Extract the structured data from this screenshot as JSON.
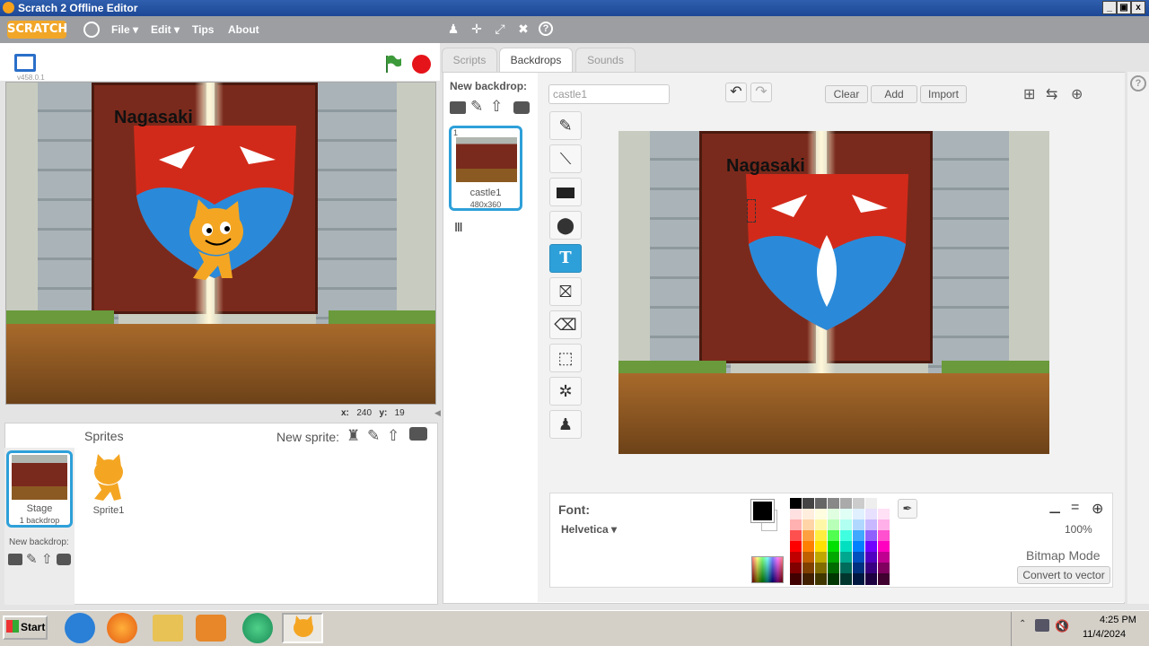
{
  "window": {
    "title": "Scratch 2 Offline Editor",
    "minimize": "_",
    "restore": "▣",
    "close": "x"
  },
  "menubar": {
    "logo": "SCRATCH",
    "items": [
      {
        "label": "File ▾"
      },
      {
        "label": "Edit ▾"
      },
      {
        "label": "Tips"
      },
      {
        "label": "About"
      }
    ],
    "tools": [
      "stamp-icon",
      "move-icon",
      "grow-icon",
      "shrink-icon",
      "help-icon"
    ]
  },
  "stage": {
    "version": "v458.0.1",
    "text_on_backdrop": "Nagasaki",
    "x_label": "x:",
    "x_value": "240",
    "y_label": "y:",
    "y_value": "19"
  },
  "sprites": {
    "title": "Sprites",
    "new_sprite_label": "New sprite:",
    "items": [
      {
        "name": "Sprite1"
      }
    ],
    "stage": {
      "label": "Stage",
      "sublabel": "1 backdrop"
    },
    "new_backdrop_label": "New backdrop:"
  },
  "tabs": [
    {
      "label": "Scripts"
    },
    {
      "label": "Backdrops"
    },
    {
      "label": "Sounds"
    }
  ],
  "backdrops": {
    "new_backdrop_label": "New backdrop:",
    "items": [
      {
        "index": "1",
        "name": "castle1",
        "size": "480x360"
      }
    ]
  },
  "paint": {
    "name_value": "castle1",
    "clear_label": "Clear",
    "add_label": "Add",
    "import_label": "Import",
    "canvas_text": "Nagasaki",
    "font_label": "Font:",
    "font_value": "Helvetica ▾",
    "zoom": "100%",
    "mode_label": "Bitmap Mode",
    "convert_label": "Convert to vector",
    "primary_color": "#000000",
    "palette": [
      [
        "#000000",
        "#444444",
        "#666666",
        "#888888",
        "#aaaaaa",
        "#cccccc",
        "#eeeeee",
        "#ffffff"
      ],
      [
        "#ffe0e0",
        "#ffeedd",
        "#fffde0",
        "#e0ffe0",
        "#e0fff5",
        "#e0f0ff",
        "#e8e0ff",
        "#ffe0f5"
      ],
      [
        "#ffb0b0",
        "#ffd5a8",
        "#fff7a8",
        "#b8ffb8",
        "#b0fff0",
        "#b0d8ff",
        "#c8b8ff",
        "#ffb0e8"
      ],
      [
        "#ff5050",
        "#ffa040",
        "#ffee40",
        "#50ff50",
        "#40ffe0",
        "#40a8ff",
        "#9060ff",
        "#ff50d0"
      ],
      [
        "#ff0000",
        "#ff8000",
        "#ffe000",
        "#00e000",
        "#00e0c0",
        "#0080ff",
        "#7000ff",
        "#ff00c0"
      ],
      [
        "#c00000",
        "#c06000",
        "#c0a800",
        "#00a800",
        "#00a890",
        "#0050c0",
        "#5000c0",
        "#c00090"
      ],
      [
        "#800000",
        "#804000",
        "#806c00",
        "#006c00",
        "#006c5c",
        "#003080",
        "#380080",
        "#800060"
      ],
      [
        "#400000",
        "#402000",
        "#403600",
        "#003600",
        "#00362e",
        "#001840",
        "#1c0040",
        "#400030"
      ]
    ]
  },
  "taskbar": {
    "start_label": "Start",
    "time": "4:25 PM",
    "date": "11/4/2024"
  },
  "colors": {
    "accent": "#2ea0d9",
    "menubar": "#9c9ea2",
    "titlebar": "#1d4796"
  }
}
